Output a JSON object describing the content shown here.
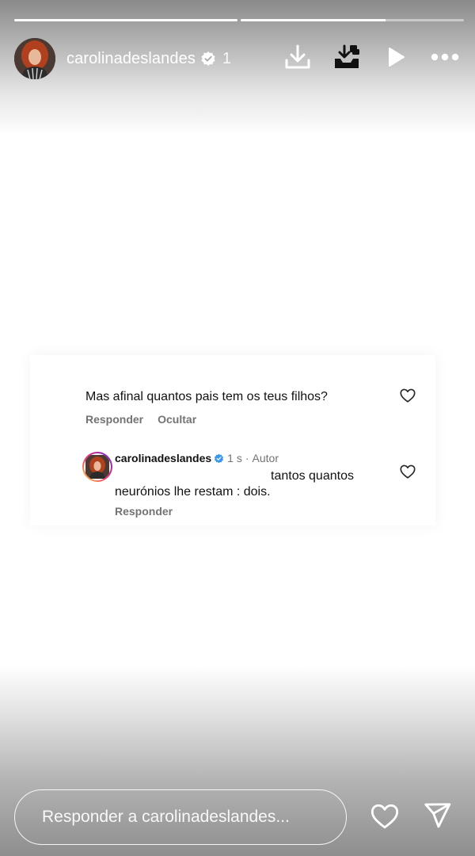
{
  "header": {
    "username": "carolinadeslandes",
    "timestamp": "1 h",
    "progress": [
      {
        "label": "story-1",
        "fill_percent": 100
      },
      {
        "label": "story-2",
        "fill_percent": 65
      }
    ],
    "icons": [
      "download-icon",
      "download-tray-icon",
      "play-icon",
      "more-icon"
    ]
  },
  "comment": {
    "text": "Mas afinal quantos pais tem os teus filhos?",
    "reply_action": "Responder",
    "hide_action": "Ocultar"
  },
  "reply": {
    "username": "carolinadeslandes",
    "time": "1 s",
    "author_label": "Autor",
    "separator": "·",
    "line1": "tantos quantos",
    "line2": "neurónios lhe restam : dois.",
    "reply_action": "Responder"
  },
  "footer": {
    "placeholder": "Responder a carolinadeslandes..."
  },
  "colors": {
    "verified": "#3897f0",
    "muted_text": "#737373",
    "ring_start": "#f9ce34",
    "ring_end": "#6228d7"
  }
}
